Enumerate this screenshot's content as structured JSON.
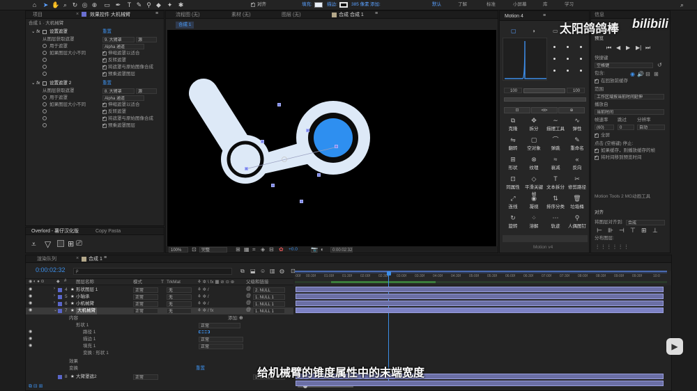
{
  "toolbar": {
    "snap_label": "对齐",
    "fill_label": "填充:",
    "stroke_label": "描边:",
    "stroke_width": "385 像素",
    "add_label": "添加:",
    "workspaces": [
      "默认",
      "了解",
      "标准",
      "小屏幕",
      "库",
      "学习"
    ],
    "brand_text": "太阳鸽鸽棒",
    "site_logo": "bilibili"
  },
  "project_panel": {
    "tab_project": "项目",
    "tab_effects": "效果控件 大机械臂",
    "breadcrumb": "合成 1 · 大机械臂",
    "effect1": {
      "name": "设置遮罩",
      "reset": "重置",
      "rows": [
        {
          "label": "从图层获取遮罩",
          "value": "9. 大臂罩"
        },
        {
          "label": "用于遮罩",
          "value": "Alpha 通道"
        },
        {
          "label": "如果图层大小不同",
          "value": "伸缩遮罩以适合"
        },
        {
          "label": "",
          "value": "反转遮罩"
        },
        {
          "label": "",
          "value": "将遮罩与原始图像合成"
        },
        {
          "label": "",
          "value": "预乘遮罩图层"
        }
      ]
    },
    "effect2": {
      "name": "设置遮罩 2",
      "reset": "重置",
      "rows": [
        {
          "label": "从图层获取遮罩",
          "value": "8. 大臂罩"
        },
        {
          "label": "用于遮罩",
          "value": "Alpha 通道"
        },
        {
          "label": "如果图层大小不同",
          "value": "伸缩遮罩以适合"
        },
        {
          "label": "",
          "value": "反转遮罩"
        },
        {
          "label": "",
          "value": "将遮罩与原始图像合成"
        },
        {
          "label": "",
          "value": "预乘遮罩图层"
        }
      ]
    },
    "tab_overlord": "Overlord - 薯仔汉化版",
    "tab_copypasta": "Copy Pasta"
  },
  "viewer": {
    "tabs": [
      "流程图 (无)",
      "素材 (无)",
      "图层 (无)",
      "合成 合成 1"
    ],
    "comp_chip": "合成 1",
    "zoom": "100%",
    "quality": "完整",
    "offset": "+0.0",
    "timecode": "0:00:02:32"
  },
  "motion": {
    "title": "Motion 4",
    "value_left": "100",
    "value_right": "100",
    "buttons": [
      "克隆",
      "拆分",
      "描摆工具",
      "弹性",
      "翻转",
      "空对象",
      "弹跳",
      "重命名",
      "形状",
      "纹理",
      "衰减",
      "反向",
      "同属性",
      "平滑关键帧",
      "文本拆分",
      "修剪路径",
      "连线",
      "凝视",
      "排序分类",
      "垃圾桶",
      "旋转",
      "溶解",
      "轨迹",
      "人偶图钉"
    ],
    "footer": "Motion v4"
  },
  "info_panel": {
    "tab_info": "信息",
    "tab_preview": "预览",
    "shortcut_label": "快捷键",
    "shortcut_value": "空格键",
    "include_label": "包含:",
    "cache_label": "在回放前缓存",
    "range_label": "范围",
    "range_value": "工作区域按当前时间延伸",
    "play_from_label": "播放自",
    "play_from_value": "当前时间",
    "framerate_label": "帧速率",
    "skip_label": "跳过",
    "resolution_label": "分辨率",
    "framerate_value": "(60)",
    "skip_value": "0",
    "resolution_value": "自动",
    "fullscreen_label": "全屏",
    "stop_label": "点击 (空格键) 停止:",
    "opt1": "如果缓存，则播放缓存的帧",
    "opt2": "将时间移到预览时间",
    "motion_tools": "Motion Tools 2 MG动画工具",
    "align_tab": "对齐",
    "align_to_label": "将图层对齐到:",
    "align_to_value": "合成",
    "distribute_label": "分布图层:"
  },
  "timeline": {
    "tab_render": "渲染队列",
    "tab_comp": "合成 1",
    "timecode": "0:00:02:32",
    "search_placeholder": "ρ",
    "col_layer": "图层名称",
    "col_mode": "模式",
    "col_trkmat": "TrkMat",
    "col_parent": "父级和链接",
    "ticks": [
      ":00f",
      "00:30f",
      "01:00f",
      "01:30f",
      "02:00f",
      "02:30f",
      "03:00f",
      "03:30f",
      "04:00f",
      "04:30f",
      "05:00f",
      "05:30f",
      "06:00f",
      "06:30f",
      "07:00f",
      "07:30f",
      "08:00f",
      "08:30f",
      "09:00f",
      "09:30f",
      "10:0"
    ],
    "layers": [
      {
        "num": "4",
        "name": "形状图层 1",
        "mode": "正常",
        "trkmat": "无",
        "parent": "2. NULL"
      },
      {
        "num": "5",
        "name": "小轴承",
        "mode": "正常",
        "trkmat": "无",
        "parent": "1. NULL 1"
      },
      {
        "num": "6",
        "name": "小机械臂",
        "mode": "正常",
        "trkmat": "无",
        "parent": "1. NULL 1"
      },
      {
        "num": "7",
        "name": "大机械臂",
        "mode": "正常",
        "trkmat": "无",
        "parent": "1. NULL 1"
      }
    ],
    "contents_label": "内容",
    "add_label": "添加:",
    "shape_label": "形状 1",
    "shape_mode": "正常",
    "sub_rows": [
      "路径 1",
      "描边 1",
      "填充 1",
      "变换 : 形状 1"
    ],
    "sub_modes": [
      "",
      "正常",
      "正常",
      ""
    ],
    "effects_label": "效果",
    "transform_label": "变换",
    "reset_label": "重置",
    "bottom_layer": {
      "num": "8",
      "name": "大臂罩遮2",
      "mode": "正常",
      "parent": "1. NULL 1"
    }
  },
  "subtitle": "给机械臂的锥度属性中的末端宽度",
  "colors": {
    "accent_blue": "#2e8ff0",
    "arm_fill": "#dde9f7",
    "layer_bar": "#6b6fa5",
    "label_purple": "#5a66c9"
  }
}
